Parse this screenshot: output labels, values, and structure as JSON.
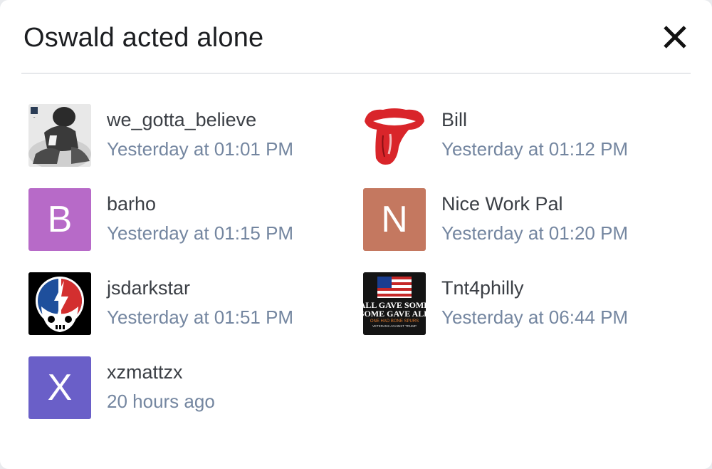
{
  "dialog": {
    "title": "Oswald acted alone",
    "close_icon": "close-icon"
  },
  "users": [
    {
      "name": "we_gotta_believe",
      "time": "Yesterday at 01:01 PM",
      "avatar": {
        "type": "photo",
        "icon": "football-player-photo"
      }
    },
    {
      "name": "Bill",
      "time": "Yesterday at 01:12 PM",
      "avatar": {
        "type": "photo",
        "icon": "rolling-stones-tongue-logo"
      }
    },
    {
      "name": "barho",
      "time": "Yesterday at 01:15 PM",
      "avatar": {
        "type": "letter",
        "letter": "B",
        "color": "#b76ac8"
      }
    },
    {
      "name": "Nice Work Pal",
      "time": "Yesterday at 01:20 PM",
      "avatar": {
        "type": "letter",
        "letter": "N",
        "color": "#c47860"
      }
    },
    {
      "name": "jsdarkstar",
      "time": "Yesterday at 01:51 PM",
      "avatar": {
        "type": "photo",
        "icon": "steal-your-face-skull-logo"
      }
    },
    {
      "name": "Tnt4philly",
      "time": "Yesterday at 06:44 PM",
      "avatar": {
        "type": "photo",
        "icon": "flag-text-banner-image",
        "text": [
          "ALL GAVE SOME",
          "SOME GAVE ALL",
          "ONE HAD BONE SPURS",
          "VETERANS AGAINST TRUMP"
        ]
      }
    },
    {
      "name": "xzmattzx",
      "time": "20 hours ago",
      "avatar": {
        "type": "letter",
        "letter": "X",
        "color": "#6a5fc8"
      }
    }
  ]
}
